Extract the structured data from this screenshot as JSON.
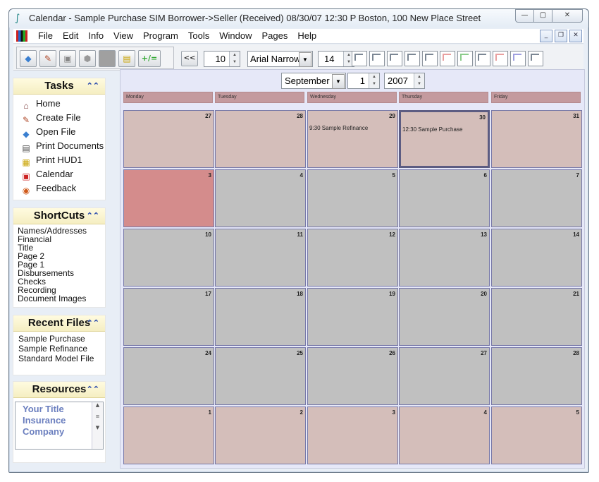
{
  "window": {
    "title": "Calendar - Sample Purchase SIM Borrower->Seller (Received) 08/30/07 12:30 P Boston, 100 New Place Street",
    "buttons": {
      "minimize": "—",
      "maximize": "▢",
      "close": "✕"
    }
  },
  "menu": [
    "File",
    "Edit",
    "Info",
    "View",
    "Program",
    "Tools",
    "Window",
    "Pages",
    "Help"
  ],
  "toolbar": {
    "nav_back": "<<",
    "size_value": "10",
    "font_value": "Arial Narrow",
    "font_size": "14",
    "plus_equal": "+/="
  },
  "tasks": {
    "title": "Tasks",
    "items": [
      {
        "label": "Home",
        "icon": "home-icon"
      },
      {
        "label": "Create File",
        "icon": "create-file-icon"
      },
      {
        "label": "Open File",
        "icon": "open-file-icon"
      },
      {
        "label": "Print Documents",
        "icon": "print-documents-icon"
      },
      {
        "label": "Print HUD1",
        "icon": "print-hud1-icon"
      },
      {
        "label": "Calendar",
        "icon": "calendar-icon"
      },
      {
        "label": "Feedback",
        "icon": "feedback-icon"
      }
    ]
  },
  "shortcuts": {
    "title": "ShortCuts",
    "items": [
      "Names/Addresses",
      "Financial",
      "Title",
      "Page 2",
      "Page 1",
      "Disbursements",
      "Checks",
      "Recording",
      "Document Images"
    ]
  },
  "recent": {
    "title": "Recent Files",
    "items": [
      "Sample Purchase",
      "Sample Refinance",
      "Standard Model File"
    ]
  },
  "resources": {
    "title": "Resources",
    "content": "Your Title Insurance Company"
  },
  "calendar": {
    "month": "September",
    "day": "1",
    "year": "2007",
    "weekdays": [
      "Monday",
      "Tuesday",
      "Wednesday",
      "Thursday",
      "Friday"
    ],
    "weeks": [
      [
        {
          "d": "27",
          "t": "pink"
        },
        {
          "d": "28",
          "t": "pink"
        },
        {
          "d": "29",
          "t": "pink",
          "ev": "9:30 Sample Refinance"
        },
        {
          "d": "30",
          "t": "pink",
          "ev": "12:30 Sample Purchase",
          "sel": true
        },
        {
          "d": "31",
          "t": "pink"
        }
      ],
      [
        {
          "d": "3",
          "t": "today"
        },
        {
          "d": "4",
          "t": "grey"
        },
        {
          "d": "5",
          "t": "grey"
        },
        {
          "d": "6",
          "t": "grey"
        },
        {
          "d": "7",
          "t": "grey"
        }
      ],
      [
        {
          "d": "10",
          "t": "grey"
        },
        {
          "d": "11",
          "t": "grey"
        },
        {
          "d": "12",
          "t": "grey"
        },
        {
          "d": "13",
          "t": "grey"
        },
        {
          "d": "14",
          "t": "grey"
        }
      ],
      [
        {
          "d": "17",
          "t": "grey"
        },
        {
          "d": "18",
          "t": "grey"
        },
        {
          "d": "19",
          "t": "grey"
        },
        {
          "d": "20",
          "t": "grey"
        },
        {
          "d": "21",
          "t": "grey"
        }
      ],
      [
        {
          "d": "24",
          "t": "grey"
        },
        {
          "d": "25",
          "t": "grey"
        },
        {
          "d": "26",
          "t": "grey"
        },
        {
          "d": "27",
          "t": "grey"
        },
        {
          "d": "28",
          "t": "grey"
        }
      ],
      [
        {
          "d": "1",
          "t": "pink"
        },
        {
          "d": "2",
          "t": "pink"
        },
        {
          "d": "3",
          "t": "pink"
        },
        {
          "d": "4",
          "t": "pink"
        },
        {
          "d": "5",
          "t": "pink"
        }
      ]
    ]
  }
}
